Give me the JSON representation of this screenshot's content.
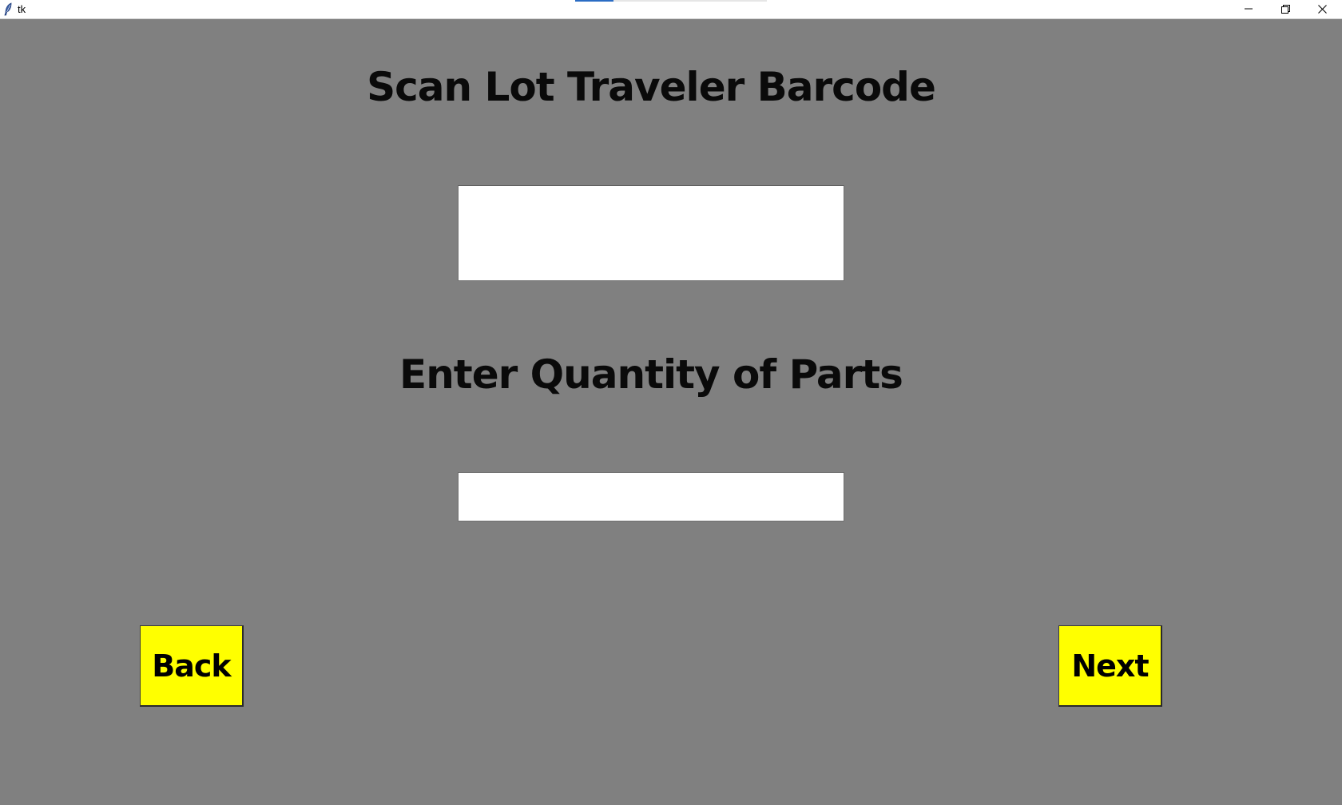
{
  "window": {
    "title": "tk",
    "controls": {
      "minimize_icon": "minimize-icon",
      "restore_icon": "restore-icon",
      "close_icon": "close-icon"
    }
  },
  "form": {
    "barcode_heading": "Scan Lot Traveler Barcode",
    "barcode_value": "",
    "quantity_heading": "Enter Quantity of Parts",
    "quantity_value": ""
  },
  "buttons": {
    "back_label": "Back",
    "next_label": "Next"
  },
  "colors": {
    "background": "#808080",
    "button_fill": "#ffff00",
    "text": "#0a0a0a",
    "entry_fill": "#ffffff"
  }
}
